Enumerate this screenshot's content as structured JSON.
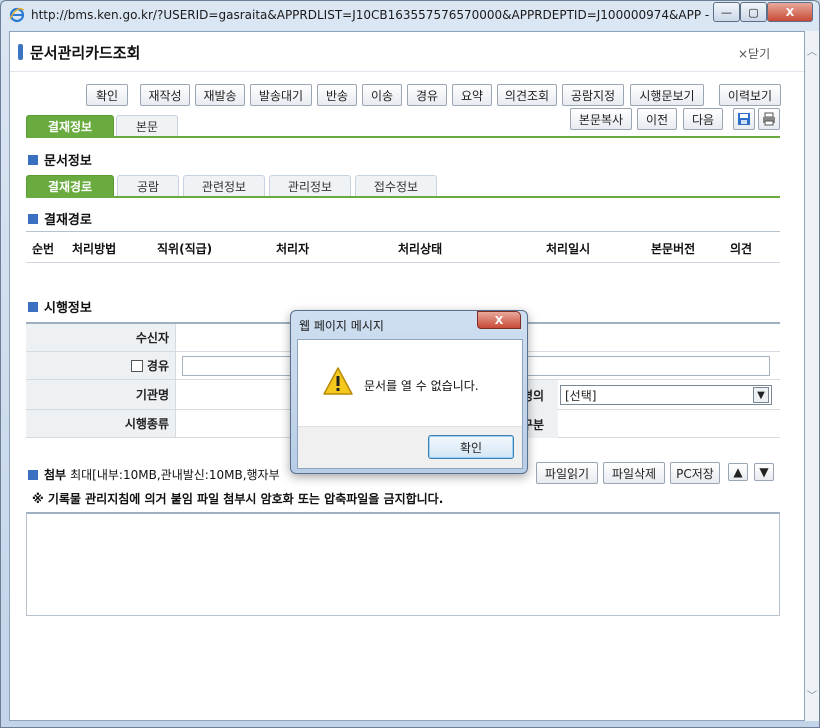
{
  "window": {
    "title": "http://bms.ken.go.kr/?USERID=gasraita&APPRDLIST=J10CB163557576570000&APPRDEPTID=J100000974&APP - Internet Ex...",
    "min_label": "—",
    "max_label": "▢",
    "close_label": "X"
  },
  "page": {
    "title": "문서관리카드조회",
    "close_label": "×닫기"
  },
  "toolbar": {
    "buttons": [
      "확인",
      "재작성",
      "재발송",
      "발송대기",
      "반송",
      "이송",
      "경유",
      "요약",
      "의견조회",
      "공람지정",
      "시행문보기",
      "이력보기"
    ],
    "buttons2": [
      "본문복사",
      "이전",
      "다음"
    ]
  },
  "main_tabs": [
    "결재정보",
    "본문"
  ],
  "sections": {
    "doc_info": "문서정보",
    "approval_path": "결재경로",
    "enforce_info": "시행정보",
    "attach_label": "첨부",
    "attach_info": "최대[내부:10MB,관내발신:10MB,행자부"
  },
  "sub_tabs": [
    "결재경로",
    "공람",
    "관련정보",
    "관리정보",
    "접수정보"
  ],
  "table_headers": [
    "순번",
    "처리방법",
    "직위(직급)",
    "처리자",
    "처리상태",
    "처리일시",
    "본문버전",
    "의견"
  ],
  "form": {
    "recipient_label": "수신자",
    "via_label": "경유",
    "agency_label": "기관명",
    "enforce_type_label": "시행종류",
    "partial_label_1": "명의",
    "partial_label_2": "구분",
    "select_value": "[선택]"
  },
  "attach_buttons": [
    "파일읽기",
    "파일삭제",
    "PC저장"
  ],
  "notice": "※ 기록물 관리지침에 의거 붙임 파일 첨부시 암호화 또는 압축파일을 금지합니다.",
  "dialog": {
    "title": "웹 페이지 메시지",
    "message": "문서를 열 수 없습니다.",
    "ok_label": "확인",
    "close_label": "X"
  },
  "icons": {
    "save": "save-icon",
    "print": "print-icon",
    "warning": "warning-icon",
    "up": "arrow-up-icon",
    "down": "arrow-down-icon"
  },
  "colors": {
    "accent_green": "#6aab3f",
    "accent_blue": "#3c74c4"
  }
}
